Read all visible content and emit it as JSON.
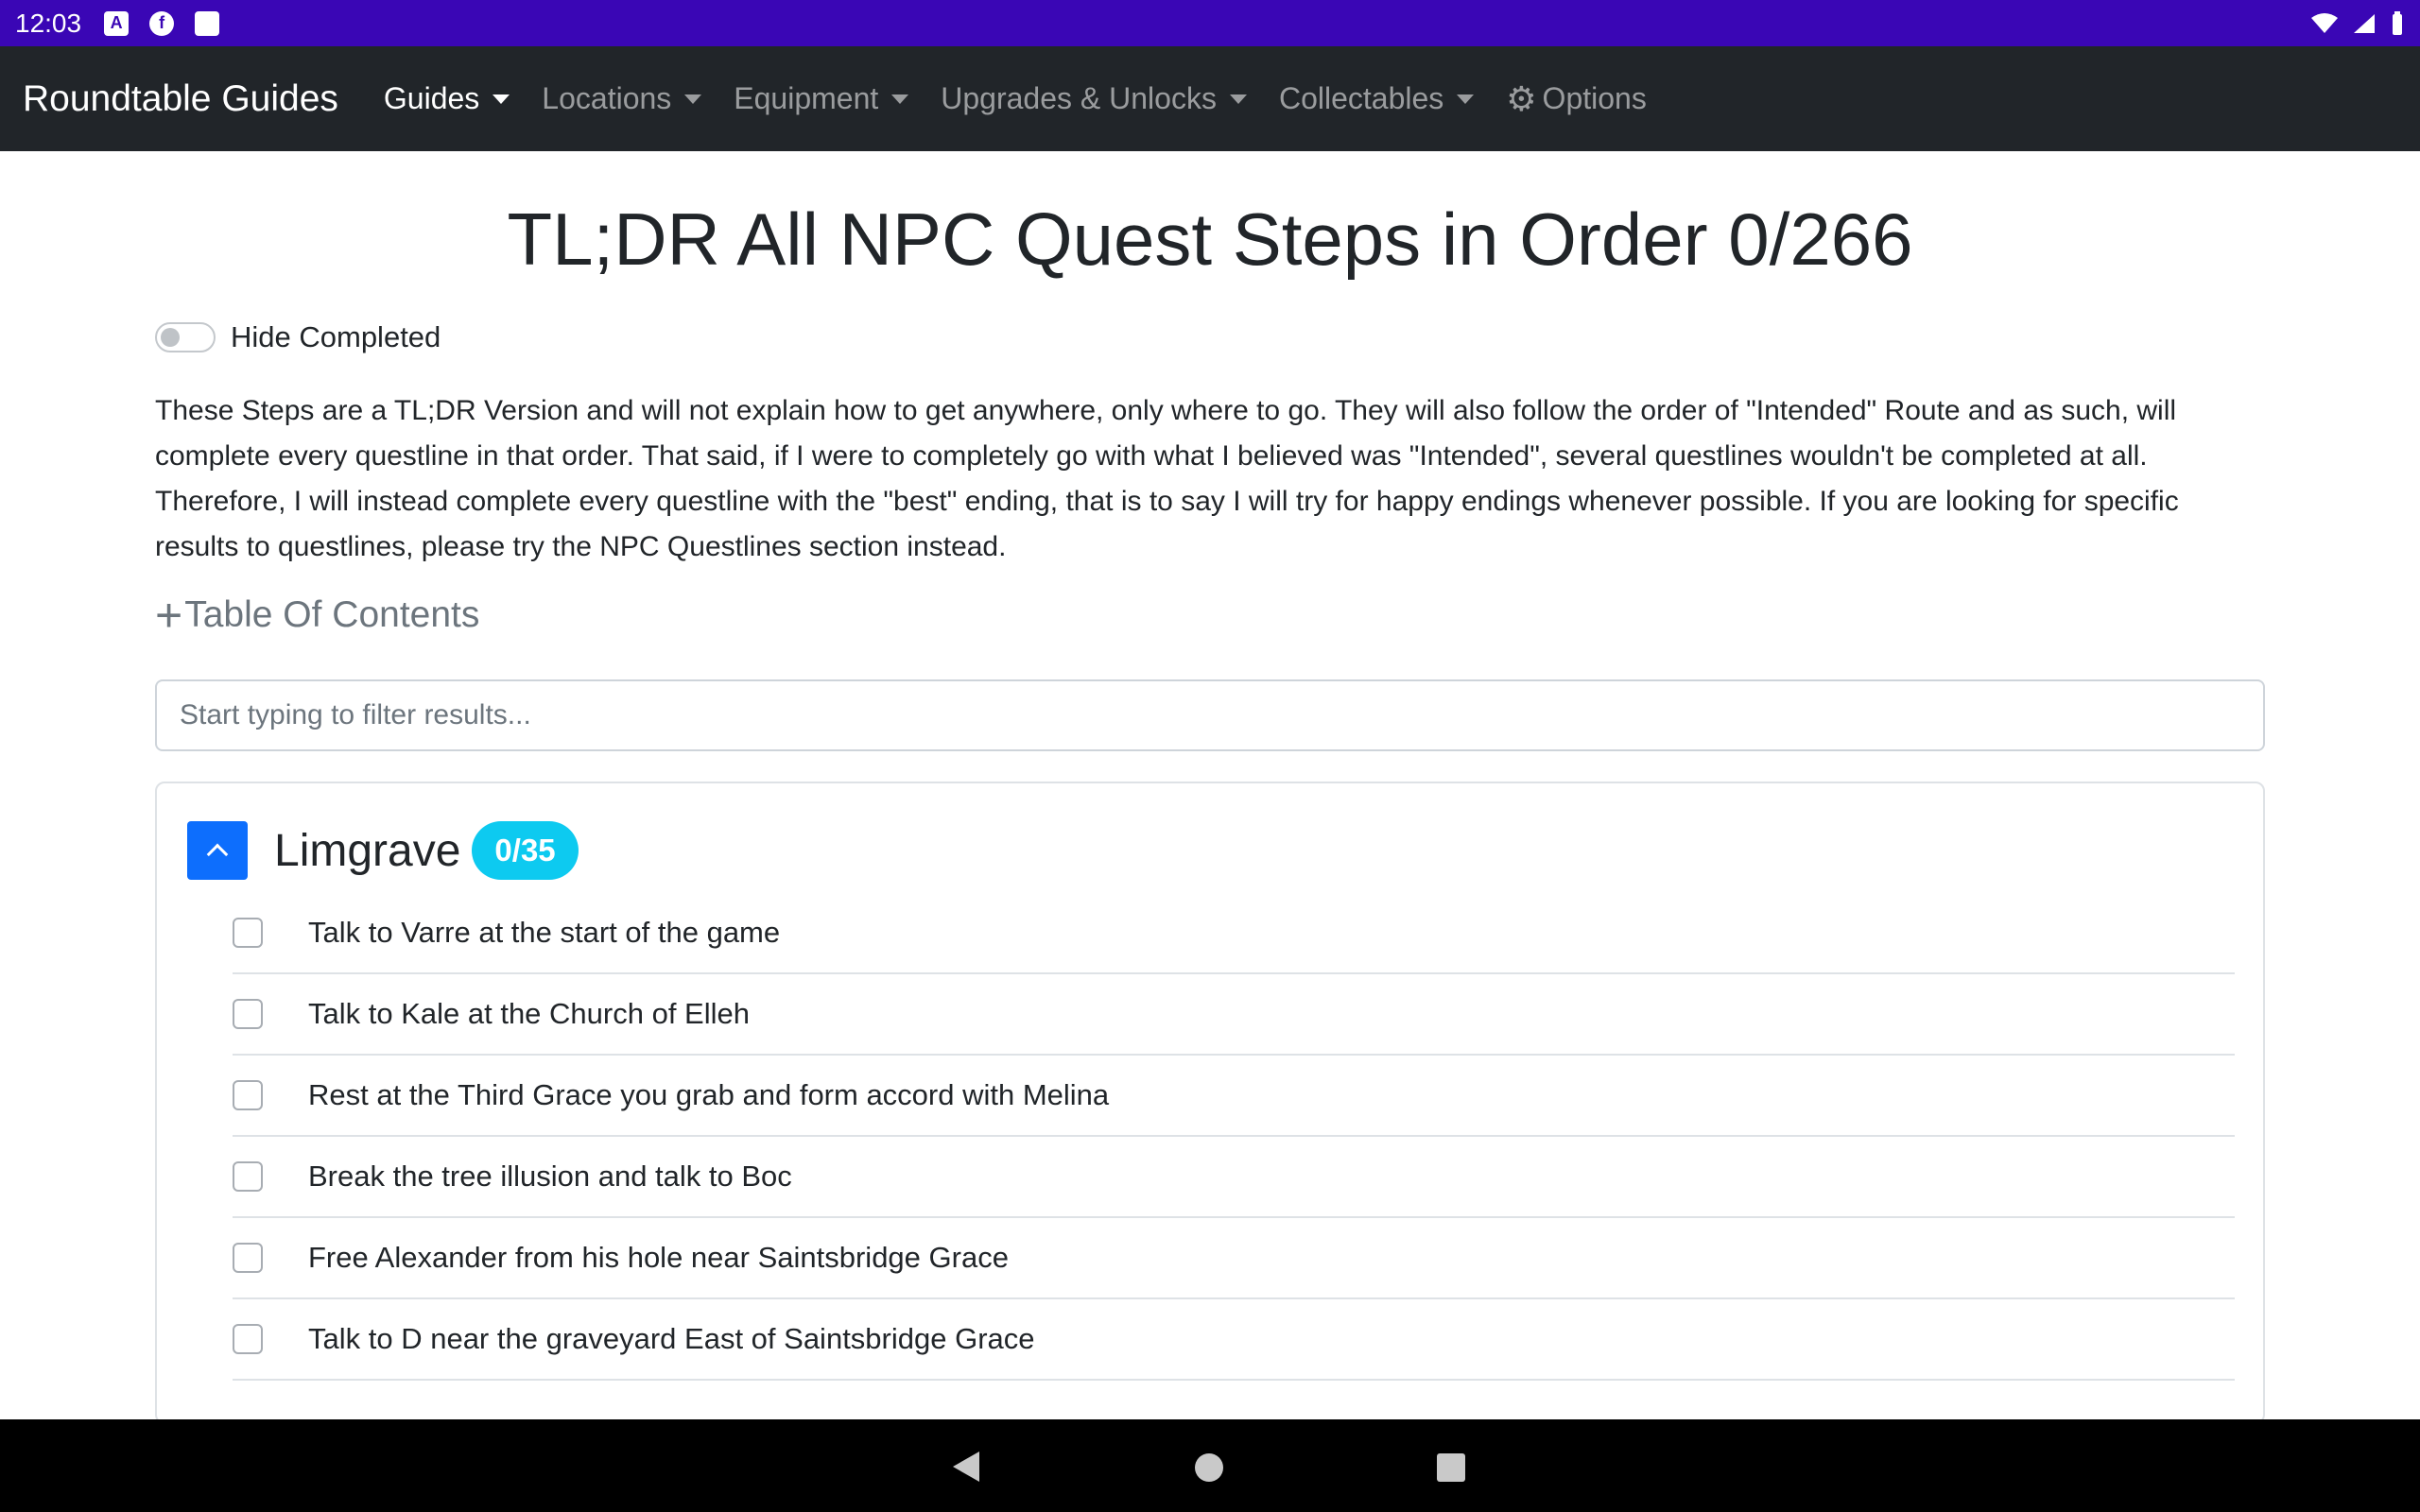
{
  "status_bar": {
    "time": "12:03"
  },
  "navbar": {
    "brand": "Roundtable Guides",
    "items": [
      {
        "label": "Guides"
      },
      {
        "label": "Locations"
      },
      {
        "label": "Equipment"
      },
      {
        "label": "Upgrades & Unlocks"
      },
      {
        "label": "Collectables"
      },
      {
        "label": "Options"
      }
    ]
  },
  "page": {
    "title": "TL;DR All NPC Quest Steps in Order 0/266",
    "hide_completed_label": "Hide Completed",
    "intro": "These Steps are a TL;DR Version and will not explain how to get anywhere, only where to go. They will also follow the order of \"Intended\" Route and as such, will complete every questline in that order. That said, if I were to completely go with what I believed was \"Intended\", several questlines wouldn't be completed at all. Therefore, I will instead complete every questline with the \"best\" ending, that is to say I will try for happy endings whenever possible. If you are looking for specific results to questlines, please try the NPC Questlines section instead.",
    "toc_label": "Table Of Contents",
    "filter_placeholder": "Start typing to filter results..."
  },
  "section": {
    "title": "Limgrave",
    "badge": "0/35",
    "steps": [
      {
        "text": "Talk to Varre at the start of the game"
      },
      {
        "text": "Talk to Kale at the Church of Elleh"
      },
      {
        "text": "Rest at the Third Grace you grab and form accord with Melina"
      },
      {
        "text": "Break the tree illusion and talk to Boc"
      },
      {
        "text": "Free Alexander from his hole near Saintsbridge Grace"
      },
      {
        "text": "Talk to D near the graveyard East of Saintsbridge Grace"
      }
    ]
  },
  "colors": {
    "status_bar": "#3a06b5",
    "navbar": "#212529",
    "primary": "#0d6efd",
    "badge": "#0dcaf0"
  }
}
